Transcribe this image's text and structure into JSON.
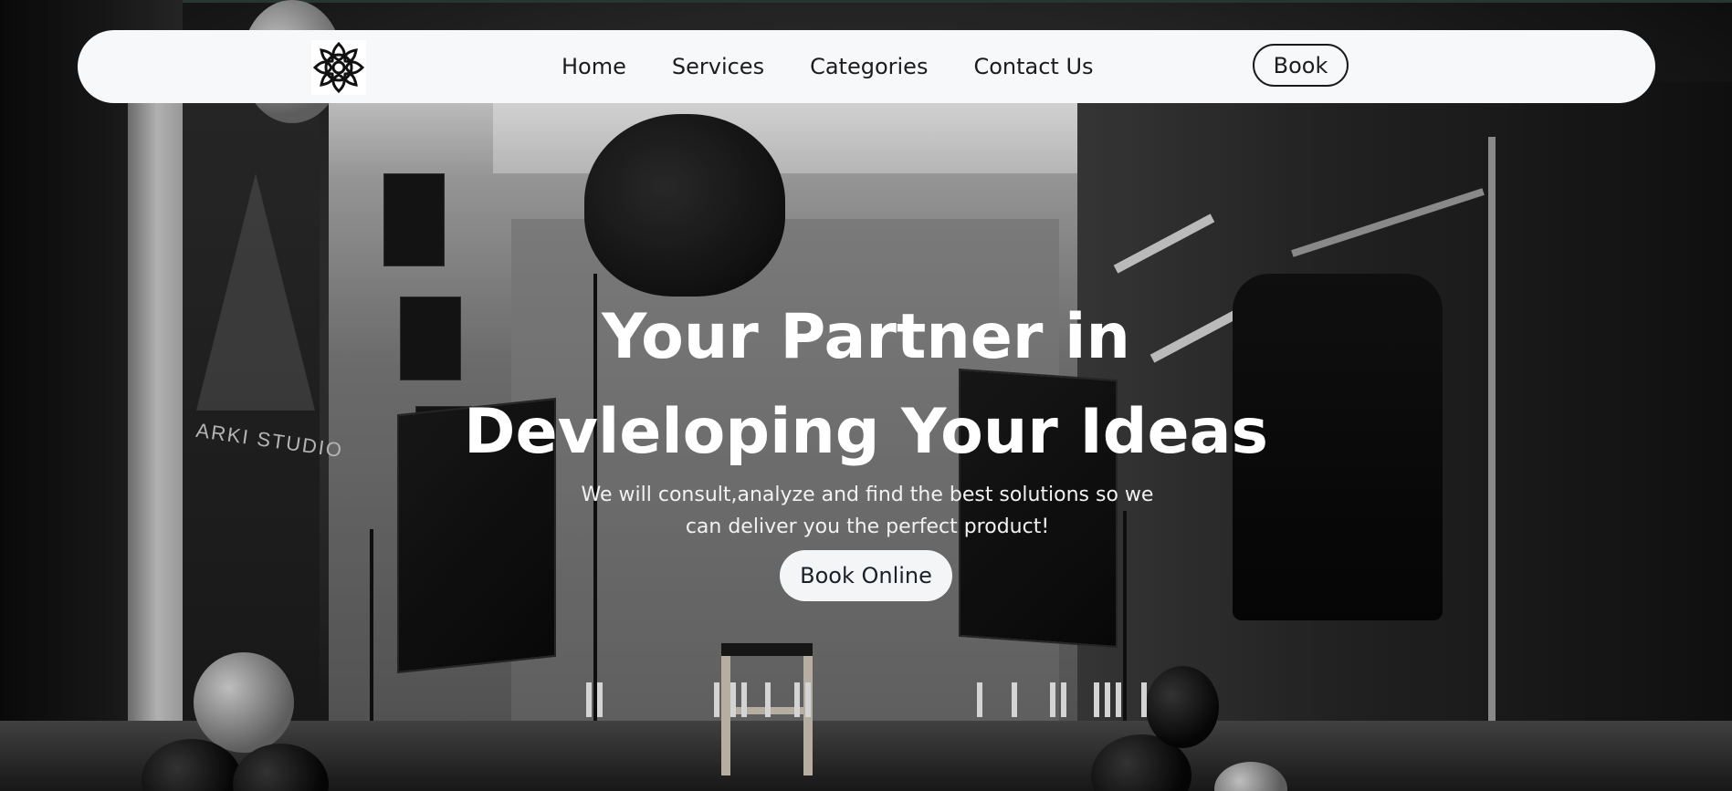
{
  "nav": {
    "logo_icon": "mandala-logo-icon",
    "links": [
      {
        "label": "Home"
      },
      {
        "label": "Services"
      },
      {
        "label": "Categories"
      },
      {
        "label": "Contact Us"
      }
    ],
    "book_label": "Book"
  },
  "hero": {
    "headline_line1": "Your Partner in",
    "headline_line2": "Devleloping Your Ideas",
    "subtitle": "We will consult,analyze and find the best solutions so we can deliver you the perfect product!",
    "cta_label": "Book Online",
    "background_image": "black-and-white-photo-studio",
    "background_sign_text": "ARKI STUDIO"
  },
  "colors": {
    "navbar_bg": "#f6f8fa",
    "nav_text": "#1c1c1c",
    "headline_text": "#ffffff",
    "cta_bg": "#f3f5f7"
  }
}
